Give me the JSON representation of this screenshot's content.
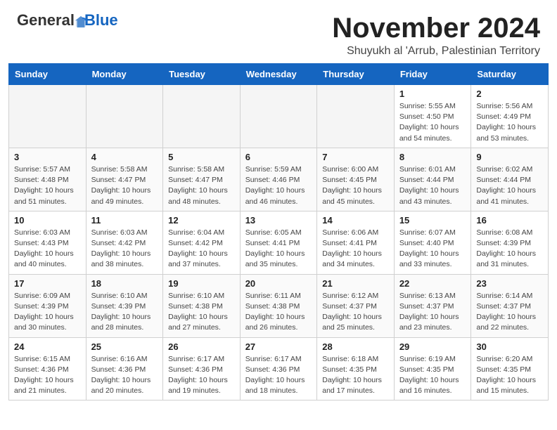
{
  "header": {
    "logo_general": "General",
    "logo_blue": "Blue",
    "month_title": "November 2024",
    "location": "Shuyukh al 'Arrub, Palestinian Territory"
  },
  "calendar": {
    "days_of_week": [
      "Sunday",
      "Monday",
      "Tuesday",
      "Wednesday",
      "Thursday",
      "Friday",
      "Saturday"
    ],
    "weeks": [
      [
        {
          "day": "",
          "info": ""
        },
        {
          "day": "",
          "info": ""
        },
        {
          "day": "",
          "info": ""
        },
        {
          "day": "",
          "info": ""
        },
        {
          "day": "",
          "info": ""
        },
        {
          "day": "1",
          "info": "Sunrise: 5:55 AM\nSunset: 4:50 PM\nDaylight: 10 hours\nand 54 minutes."
        },
        {
          "day": "2",
          "info": "Sunrise: 5:56 AM\nSunset: 4:49 PM\nDaylight: 10 hours\nand 53 minutes."
        }
      ],
      [
        {
          "day": "3",
          "info": "Sunrise: 5:57 AM\nSunset: 4:48 PM\nDaylight: 10 hours\nand 51 minutes."
        },
        {
          "day": "4",
          "info": "Sunrise: 5:58 AM\nSunset: 4:47 PM\nDaylight: 10 hours\nand 49 minutes."
        },
        {
          "day": "5",
          "info": "Sunrise: 5:58 AM\nSunset: 4:47 PM\nDaylight: 10 hours\nand 48 minutes."
        },
        {
          "day": "6",
          "info": "Sunrise: 5:59 AM\nSunset: 4:46 PM\nDaylight: 10 hours\nand 46 minutes."
        },
        {
          "day": "7",
          "info": "Sunrise: 6:00 AM\nSunset: 4:45 PM\nDaylight: 10 hours\nand 45 minutes."
        },
        {
          "day": "8",
          "info": "Sunrise: 6:01 AM\nSunset: 4:44 PM\nDaylight: 10 hours\nand 43 minutes."
        },
        {
          "day": "9",
          "info": "Sunrise: 6:02 AM\nSunset: 4:44 PM\nDaylight: 10 hours\nand 41 minutes."
        }
      ],
      [
        {
          "day": "10",
          "info": "Sunrise: 6:03 AM\nSunset: 4:43 PM\nDaylight: 10 hours\nand 40 minutes."
        },
        {
          "day": "11",
          "info": "Sunrise: 6:03 AM\nSunset: 4:42 PM\nDaylight: 10 hours\nand 38 minutes."
        },
        {
          "day": "12",
          "info": "Sunrise: 6:04 AM\nSunset: 4:42 PM\nDaylight: 10 hours\nand 37 minutes."
        },
        {
          "day": "13",
          "info": "Sunrise: 6:05 AM\nSunset: 4:41 PM\nDaylight: 10 hours\nand 35 minutes."
        },
        {
          "day": "14",
          "info": "Sunrise: 6:06 AM\nSunset: 4:41 PM\nDaylight: 10 hours\nand 34 minutes."
        },
        {
          "day": "15",
          "info": "Sunrise: 6:07 AM\nSunset: 4:40 PM\nDaylight: 10 hours\nand 33 minutes."
        },
        {
          "day": "16",
          "info": "Sunrise: 6:08 AM\nSunset: 4:39 PM\nDaylight: 10 hours\nand 31 minutes."
        }
      ],
      [
        {
          "day": "17",
          "info": "Sunrise: 6:09 AM\nSunset: 4:39 PM\nDaylight: 10 hours\nand 30 minutes."
        },
        {
          "day": "18",
          "info": "Sunrise: 6:10 AM\nSunset: 4:39 PM\nDaylight: 10 hours\nand 28 minutes."
        },
        {
          "day": "19",
          "info": "Sunrise: 6:10 AM\nSunset: 4:38 PM\nDaylight: 10 hours\nand 27 minutes."
        },
        {
          "day": "20",
          "info": "Sunrise: 6:11 AM\nSunset: 4:38 PM\nDaylight: 10 hours\nand 26 minutes."
        },
        {
          "day": "21",
          "info": "Sunrise: 6:12 AM\nSunset: 4:37 PM\nDaylight: 10 hours\nand 25 minutes."
        },
        {
          "day": "22",
          "info": "Sunrise: 6:13 AM\nSunset: 4:37 PM\nDaylight: 10 hours\nand 23 minutes."
        },
        {
          "day": "23",
          "info": "Sunrise: 6:14 AM\nSunset: 4:37 PM\nDaylight: 10 hours\nand 22 minutes."
        }
      ],
      [
        {
          "day": "24",
          "info": "Sunrise: 6:15 AM\nSunset: 4:36 PM\nDaylight: 10 hours\nand 21 minutes."
        },
        {
          "day": "25",
          "info": "Sunrise: 6:16 AM\nSunset: 4:36 PM\nDaylight: 10 hours\nand 20 minutes."
        },
        {
          "day": "26",
          "info": "Sunrise: 6:17 AM\nSunset: 4:36 PM\nDaylight: 10 hours\nand 19 minutes."
        },
        {
          "day": "27",
          "info": "Sunrise: 6:17 AM\nSunset: 4:36 PM\nDaylight: 10 hours\nand 18 minutes."
        },
        {
          "day": "28",
          "info": "Sunrise: 6:18 AM\nSunset: 4:35 PM\nDaylight: 10 hours\nand 17 minutes."
        },
        {
          "day": "29",
          "info": "Sunrise: 6:19 AM\nSunset: 4:35 PM\nDaylight: 10 hours\nand 16 minutes."
        },
        {
          "day": "30",
          "info": "Sunrise: 6:20 AM\nSunset: 4:35 PM\nDaylight: 10 hours\nand 15 minutes."
        }
      ]
    ]
  }
}
